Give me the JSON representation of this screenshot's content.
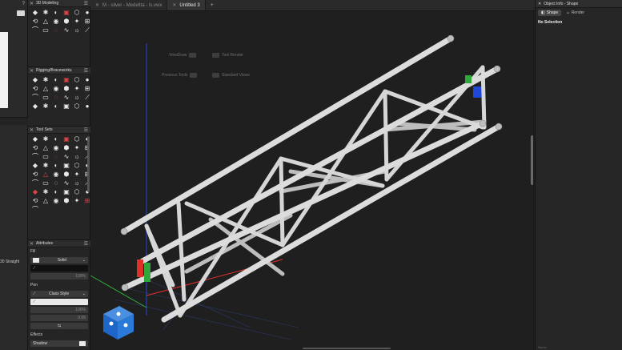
{
  "left_panel": {
    "help_glyph": "?",
    "cut_label": "30 Straight"
  },
  "palettes": {
    "modeling": {
      "title": "3D Modeling",
      "icons": [
        "extrude-icon",
        "sweep-icon",
        "shell-icon",
        "loft-icon",
        "solid-icon",
        "sphere-icon",
        "tool-icon",
        "twist-icon",
        "cone-icon",
        "cylinder-icon",
        "subdiv-icon",
        "taper-icon",
        "hemisphere-icon",
        "dome-icon",
        "shape-icon",
        "mesh-icon",
        "fillet-icon",
        "network-icon"
      ]
    },
    "rigging": {
      "title": "Rigging/Braceworks",
      "icons": [
        "truss-icon",
        "hoist-icon",
        "cable-icon",
        "bridle-icon",
        "calc-icon",
        "beam-icon",
        "point-icon",
        "clamp-icon",
        "pipe-icon",
        "system-icon",
        "load-icon",
        "base-icon",
        "grid-icon",
        "align-icon",
        "insert-icon",
        "edit-icon",
        "cross-icon",
        "spline-icon",
        "mark-icon",
        "tool-icon",
        "trim-icon",
        "chain-icon",
        "pickup-icon",
        "crane-icon"
      ]
    },
    "tools": {
      "title": "Tool Sets",
      "icons": [
        "line-icon",
        "polyline-icon",
        "arc-icon",
        "rect-icon",
        "round-rect-icon",
        "circle-icon",
        "dims-icon",
        "text-icon",
        "callout-icon",
        "curve-icon",
        "wave-icon",
        "sun-icon",
        "chain-icon",
        "polygon-icon",
        "move-icon",
        "mirror-icon",
        "offset-icon",
        "fillet-icon",
        "grid-icon",
        "split-icon",
        "clip-icon",
        "join-icon",
        "node-icon",
        "pan-icon",
        "door-icon",
        "window-icon",
        "stair-icon",
        "slab-icon",
        "roof-icon",
        "wall-icon",
        "light-icon",
        "lamp-icon",
        "focus-icon",
        "label-icon",
        "gobo-icon",
        "fixture-icon",
        "plant-icon",
        "tree-icon",
        "ground-icon",
        "site-icon",
        "hard-icon",
        "road-icon",
        "space-icon",
        "seat-icon",
        "stage-icon",
        "speaker-icon",
        "video-icon",
        "key-icon",
        "stack-icon"
      ]
    },
    "attributes": {
      "title": "Attributes",
      "fill_label": "Fill",
      "fill_value": "Solid",
      "opacity_value": "100%",
      "pen_label": "Pen",
      "pen_value": "Class Style",
      "pen_opacity_value": "100%",
      "line_weight_value": "0.05",
      "effects_label": "Effects",
      "shadow_label": "Shadow"
    }
  },
  "tabs": [
    {
      "label": "M - silver - Medeltta - ls.vwx",
      "active": false
    },
    {
      "label": "Untitled 3",
      "active": true
    }
  ],
  "tab_add": "+",
  "canvas": {
    "view_buttons": {
      "view_draw": "ViewDraw",
      "top_render": "Tool Render",
      "previous_tools": "Previous Tools",
      "standard_views": "Standard Views"
    },
    "colors": {
      "background": "#1f1f1f",
      "truss": "#d9d9d9",
      "red_axis": "#e0302a",
      "green_axis": "#2ea83b",
      "blue_axis": "#2147d9"
    }
  },
  "object_info": {
    "title": "Object Info - Shape",
    "tabs": [
      {
        "label": "Shape",
        "active": true
      },
      {
        "label": "Render",
        "active": false
      }
    ],
    "status": "No Selection",
    "footer": "Name"
  }
}
